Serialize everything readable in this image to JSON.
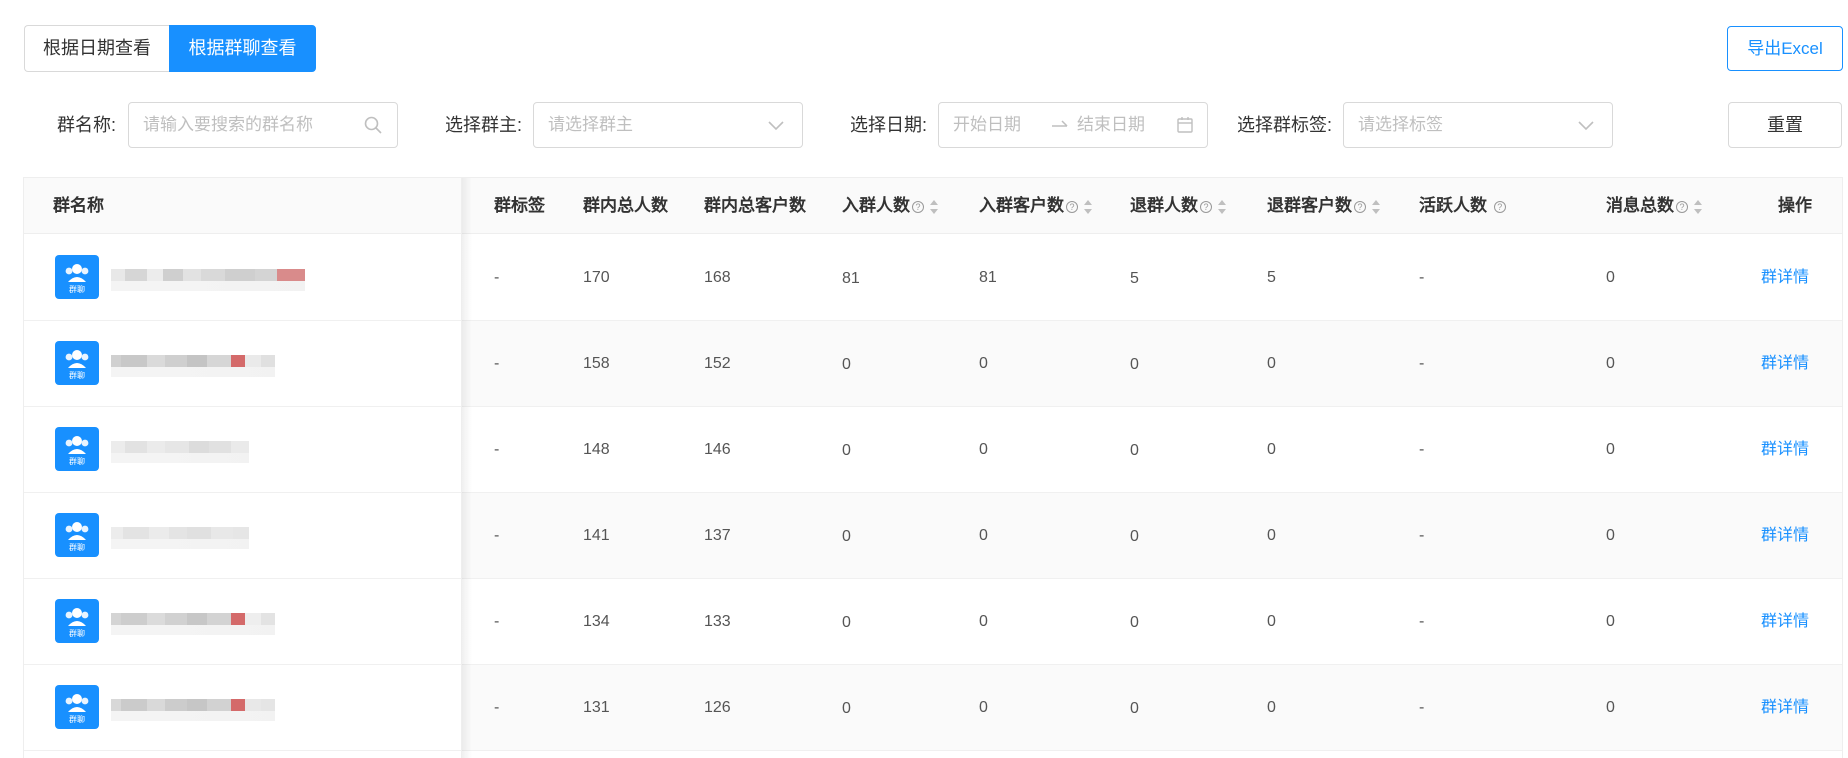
{
  "toggle": {
    "by_date": "根据日期查看",
    "by_group": "根据群聊查看"
  },
  "export_label": "导出Excel",
  "filters": {
    "group_name_label": "群名称:",
    "group_name_placeholder": "请输入要搜索的群名称",
    "owner_label": "选择群主:",
    "owner_placeholder": "请选择群主",
    "date_label": "选择日期:",
    "start_placeholder": "开始日期",
    "end_placeholder": "结束日期",
    "tag_label": "选择群标签:",
    "tag_placeholder": "请选择标签",
    "reset_label": "重置"
  },
  "table": {
    "columns": {
      "name": "群名称",
      "tag": "群标签",
      "total": "群内总人数",
      "total_customers": "群内总客户数",
      "joined": "入群人数",
      "joined_customers": "入群客户数",
      "left": "退群人数",
      "left_customers": "退群客户数",
      "active": "活跃人数",
      "messages": "消息总数",
      "action": "操作"
    },
    "avatar_tag": "群聊",
    "rows": [
      {
        "tag": "-",
        "total": "170",
        "total_customers": "168",
        "joined": "81",
        "joined_customers": "81",
        "left": "5",
        "left_customers": "5",
        "active": "-",
        "messages": "0",
        "action": "群详情"
      },
      {
        "tag": "-",
        "total": "158",
        "total_customers": "152",
        "joined": "0",
        "joined_customers": "0",
        "left": "0",
        "left_customers": "0",
        "active": "-",
        "messages": "0",
        "action": "群详情"
      },
      {
        "tag": "-",
        "total": "148",
        "total_customers": "146",
        "joined": "0",
        "joined_customers": "0",
        "left": "0",
        "left_customers": "0",
        "active": "-",
        "messages": "0",
        "action": "群详情"
      },
      {
        "tag": "-",
        "total": "141",
        "total_customers": "137",
        "joined": "0",
        "joined_customers": "0",
        "left": "0",
        "left_customers": "0",
        "active": "-",
        "messages": "0",
        "action": "群详情"
      },
      {
        "tag": "-",
        "total": "134",
        "total_customers": "133",
        "joined": "0",
        "joined_customers": "0",
        "left": "0",
        "left_customers": "0",
        "active": "-",
        "messages": "0",
        "action": "群详情"
      },
      {
        "tag": "-",
        "total": "131",
        "total_customers": "126",
        "joined": "0",
        "joined_customers": "0",
        "left": "0",
        "left_customers": "0",
        "active": "-",
        "messages": "0",
        "action": "群详情"
      }
    ]
  },
  "colors": {
    "primary": "#1890ff",
    "border": "#d9d9d9",
    "header_bg": "#fafafa"
  },
  "icons": {
    "search": "search-icon",
    "dropdown": "chevron-down-icon",
    "calendar": "calendar-icon",
    "arrow": "arrow-right-icon",
    "avatar": "group-chat-icon"
  }
}
